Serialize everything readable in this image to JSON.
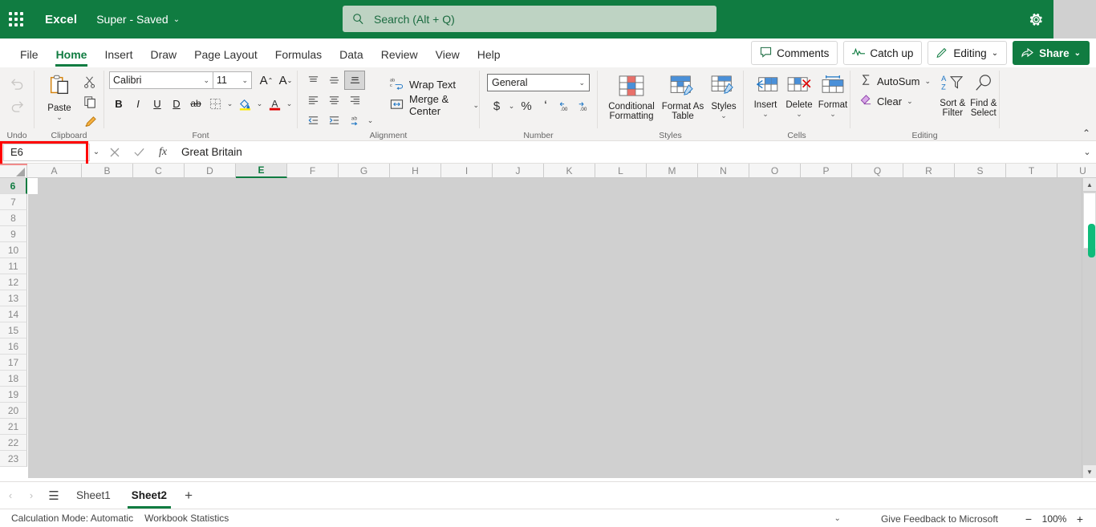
{
  "titlebar": {
    "waffle_name": "app-launcher-icon",
    "app_name": "Excel",
    "doc_title": "Super  -  Saved",
    "doc_chevron": "⌄",
    "gear_name": "settings-gear-icon"
  },
  "search": {
    "placeholder": "Search (Alt + Q)",
    "value": ""
  },
  "tabs": [
    {
      "label": "File",
      "active": false
    },
    {
      "label": "Home",
      "active": true
    },
    {
      "label": "Insert",
      "active": false
    },
    {
      "label": "Draw",
      "active": false
    },
    {
      "label": "Page Layout",
      "active": false
    },
    {
      "label": "Formulas",
      "active": false
    },
    {
      "label": "Data",
      "active": false
    },
    {
      "label": "Review",
      "active": false
    },
    {
      "label": "View",
      "active": false
    },
    {
      "label": "Help",
      "active": false
    }
  ],
  "tab_actions": {
    "comments": "Comments",
    "catch_up": "Catch up",
    "editing": "Editing",
    "share": "Share",
    "chevron": "⌄"
  },
  "ribbon": {
    "groups": {
      "undo": {
        "label": "Undo",
        "undo_title": "Undo",
        "redo_title": "Redo"
      },
      "clipboard": {
        "label": "Clipboard",
        "paste": "Paste",
        "paste_chevron": "⌄",
        "cut_title": "Cut",
        "copy_title": "Copy",
        "format_painter_title": "Format Painter"
      },
      "font": {
        "label": "Font",
        "font_name": "Calibri",
        "font_size": "11",
        "chevron": "⌄",
        "grow_font": "A",
        "shrink_font": "A",
        "bold": "B",
        "italic": "I",
        "underline": "U",
        "double_underline": "D",
        "strikethrough": "ab",
        "borders_title": "Borders",
        "fill_color_title": "Fill Color",
        "font_color_title": "Font Color"
      },
      "alignment": {
        "label": "Alignment",
        "wrap_text": "Wrap Text",
        "merge_center": "Merge & Center",
        "chevron": "⌄",
        "align_top_title": "Top Align",
        "align_middle_title": "Middle Align",
        "align_bottom_title": "Bottom Align",
        "align_left_title": "Align Left",
        "align_center_title": "Center",
        "align_right_title": "Align Right",
        "decrease_indent_title": "Decrease Indent",
        "increase_indent_title": "Increase Indent",
        "orientation_title": "Orientation"
      },
      "number": {
        "label": "Number",
        "format": "General",
        "chevron": "⌄",
        "currency": "$",
        "percent": "%",
        "comma": "‘",
        "increase_decimal_title": "Increase Decimal",
        "decrease_decimal_title": "Decrease Decimal"
      },
      "styles": {
        "label": "Styles",
        "conditional_formatting": "Conditional Formatting",
        "format_as_table": "Format As Table",
        "styles": "Styles",
        "chevron": "⌄"
      },
      "cells": {
        "label": "Cells",
        "insert": "Insert",
        "delete": "Delete",
        "format": "Format",
        "chevron": "⌄"
      },
      "editing": {
        "label": "Editing",
        "autosum": "AutoSum",
        "clear": "Clear",
        "sort_filter": "Sort & Filter",
        "find_select": "Find & Select",
        "chevron": "⌄"
      }
    },
    "collapse": "⌃"
  },
  "formula_bar": {
    "name_box": "E6",
    "name_box_chevron": "⌄",
    "cancel_name": "cancel-icon",
    "enter_name": "confirm-icon",
    "fx": "fx",
    "value": "Great Britain",
    "expand_chevron": "⌄"
  },
  "grid": {
    "columns": [
      "A",
      "B",
      "C",
      "D",
      "E",
      "F",
      "G",
      "H",
      "I",
      "J",
      "K",
      "L",
      "M",
      "N",
      "O",
      "P",
      "Q",
      "R",
      "S",
      "T",
      "U"
    ],
    "selected_column": "E",
    "rows": [
      "6",
      "7",
      "8",
      "9",
      "10",
      "11",
      "12",
      "13",
      "14",
      "15",
      "16",
      "17",
      "18",
      "19",
      "20",
      "21",
      "22",
      "23"
    ],
    "selected_row": "6",
    "scroll_up": "▲",
    "scroll_down": "▼"
  },
  "sheet_bar": {
    "prev": "‹",
    "next": "›",
    "all_sheets": "☰",
    "tabs": [
      {
        "label": "Sheet1",
        "active": false
      },
      {
        "label": "Sheet2",
        "active": true
      }
    ],
    "add": "+"
  },
  "status_bar": {
    "calculation_mode": "Calculation Mode: Automatic",
    "workbook_statistics": "Workbook Statistics",
    "chevron": "⌄",
    "feedback": "Give Feedback to Microsoft",
    "zoom_out": "−",
    "zoom_level": "100%",
    "zoom_in": "+"
  },
  "colors": {
    "brand_green": "#107c41",
    "search_bg": "#bed3c3",
    "ribbon_bg": "#f3f2f1",
    "grid_overlay": "#d0d0d0",
    "highlight_red": "#ff0000",
    "scroll_thumb": "#0fbb7a"
  }
}
